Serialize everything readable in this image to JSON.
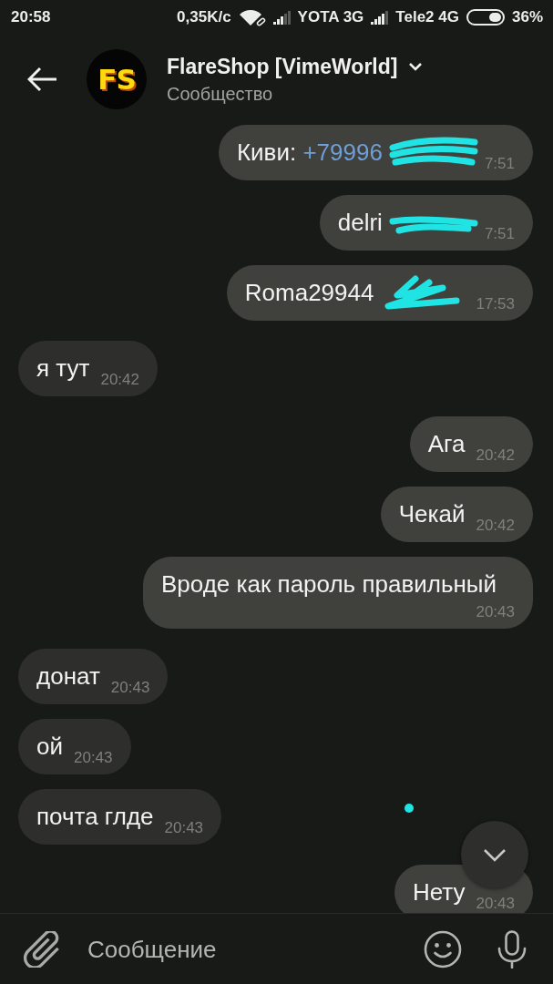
{
  "status_bar": {
    "time": "20:58",
    "network_speed": "0,35K/с",
    "carrier_1": "YOTA 3G",
    "carrier_2": "Tele2 4G",
    "battery": "36%"
  },
  "header": {
    "avatar_text": "FS",
    "title": "FlareShop [VimeWorld]",
    "subtitle": "Сообщество"
  },
  "messages": [
    {
      "kind": "outgoing",
      "text": "Киви:",
      "link": "+79996",
      "time": "7:51",
      "redacted": true
    },
    {
      "kind": "outgoing",
      "text": "delri",
      "time": "7:51",
      "redacted": true
    },
    {
      "kind": "outgoing",
      "text": "Roma29944",
      "time": "17:53",
      "redacted": true
    },
    {
      "kind": "incoming",
      "text": "я тут",
      "time": "20:42",
      "redacted": false
    },
    {
      "kind": "outgoing",
      "text": "Ага",
      "time": "20:42",
      "redacted": false
    },
    {
      "kind": "outgoing",
      "text": "Чекай",
      "time": "20:42",
      "redacted": false
    },
    {
      "kind": "outgoing",
      "text": "Вроде как пароль правильный",
      "time": "20:43",
      "redacted": false
    },
    {
      "kind": "incoming",
      "text": "донат",
      "time": "20:43",
      "redacted": false
    },
    {
      "kind": "incoming",
      "text": "ой",
      "time": "20:43",
      "redacted": false
    },
    {
      "kind": "incoming",
      "text": "почта глде",
      "time": "20:43",
      "redacted": false
    },
    {
      "kind": "outgoing",
      "text": "Нету",
      "time": "20:43",
      "redacted": false
    }
  ],
  "composer": {
    "placeholder": "Сообщение"
  }
}
